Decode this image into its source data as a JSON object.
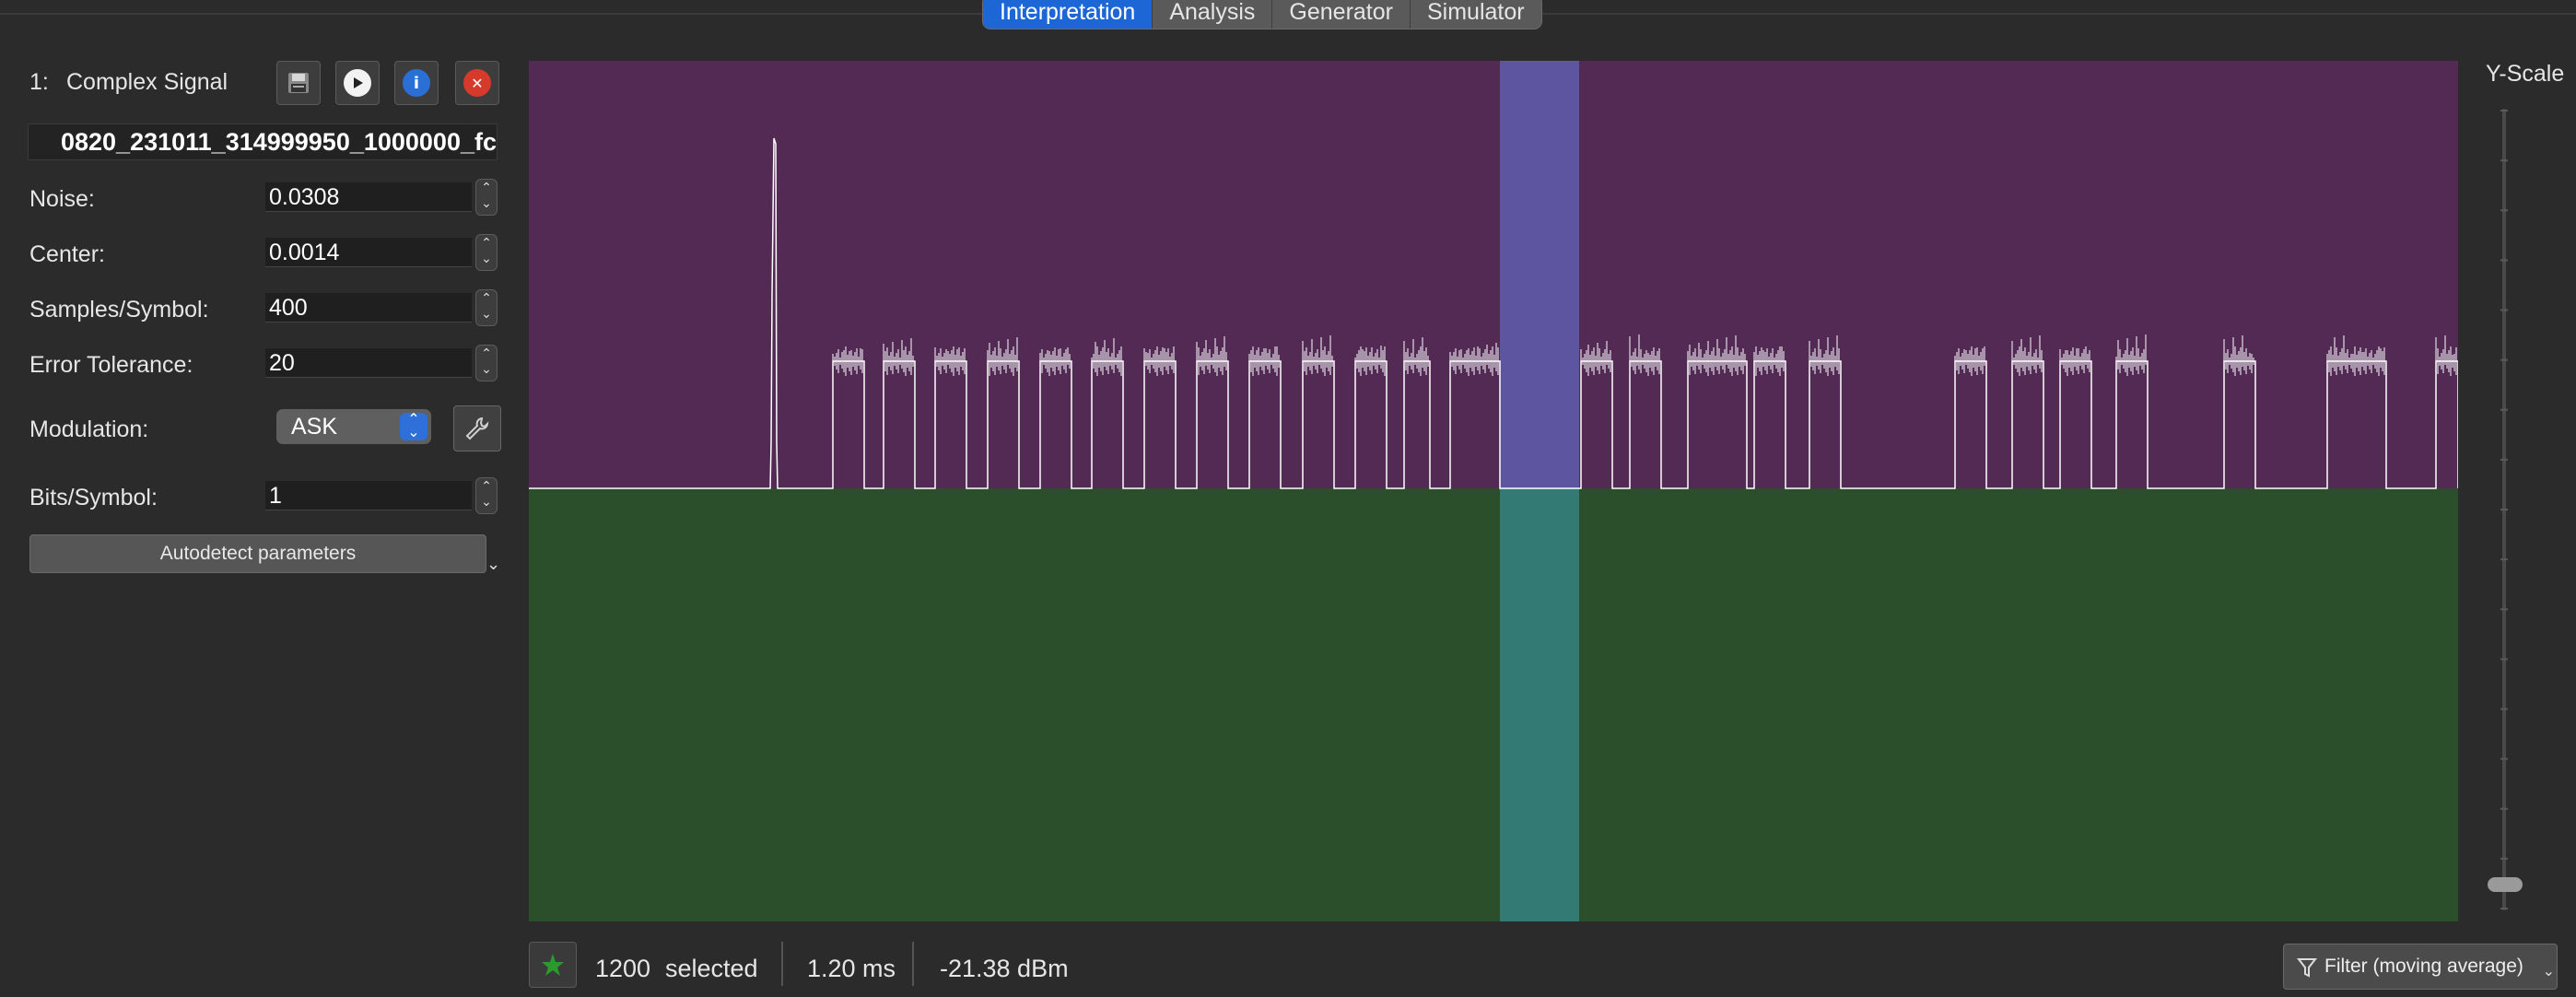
{
  "tabs": [
    {
      "label": "Interpretation",
      "active": true
    },
    {
      "label": "Analysis",
      "active": false
    },
    {
      "label": "Generator",
      "active": false
    },
    {
      "label": "Simulator",
      "active": false
    }
  ],
  "signal_panel": {
    "index": "1:",
    "name": "Complex Signal",
    "filename": "0820_231011_314999950_1000000_fc",
    "fields": {
      "noise": {
        "label": "Noise:",
        "value": "0.0308"
      },
      "center": {
        "label": "Center:",
        "value": "0.0014"
      },
      "samples_per_symbol": {
        "label": "Samples/Symbol:",
        "value": "400"
      },
      "error_tolerance": {
        "label": "Error Tolerance:",
        "value": "20"
      },
      "modulation": {
        "label": "Modulation:",
        "value": "ASK"
      },
      "bits_per_symbol": {
        "label": "Bits/Symbol:",
        "value": "1"
      }
    },
    "autodetect_label": "Autodetect parameters",
    "icons": [
      "save-icon",
      "play-icon",
      "info-icon",
      "close-icon"
    ]
  },
  "view": {
    "y_scale_label": "Y-Scale",
    "colors": {
      "upper": "#522a54",
      "lower": "#2c4f2b",
      "selection_upper": "#5e55a0",
      "selection_lower": "#347a74",
      "waveform": "#ffffff"
    }
  },
  "status": {
    "selected_count": "1200",
    "selected_word": "selected",
    "duration": "1.20 ms",
    "power": "-21.38 dBm",
    "filter_label": "Filter (moving average)"
  }
}
